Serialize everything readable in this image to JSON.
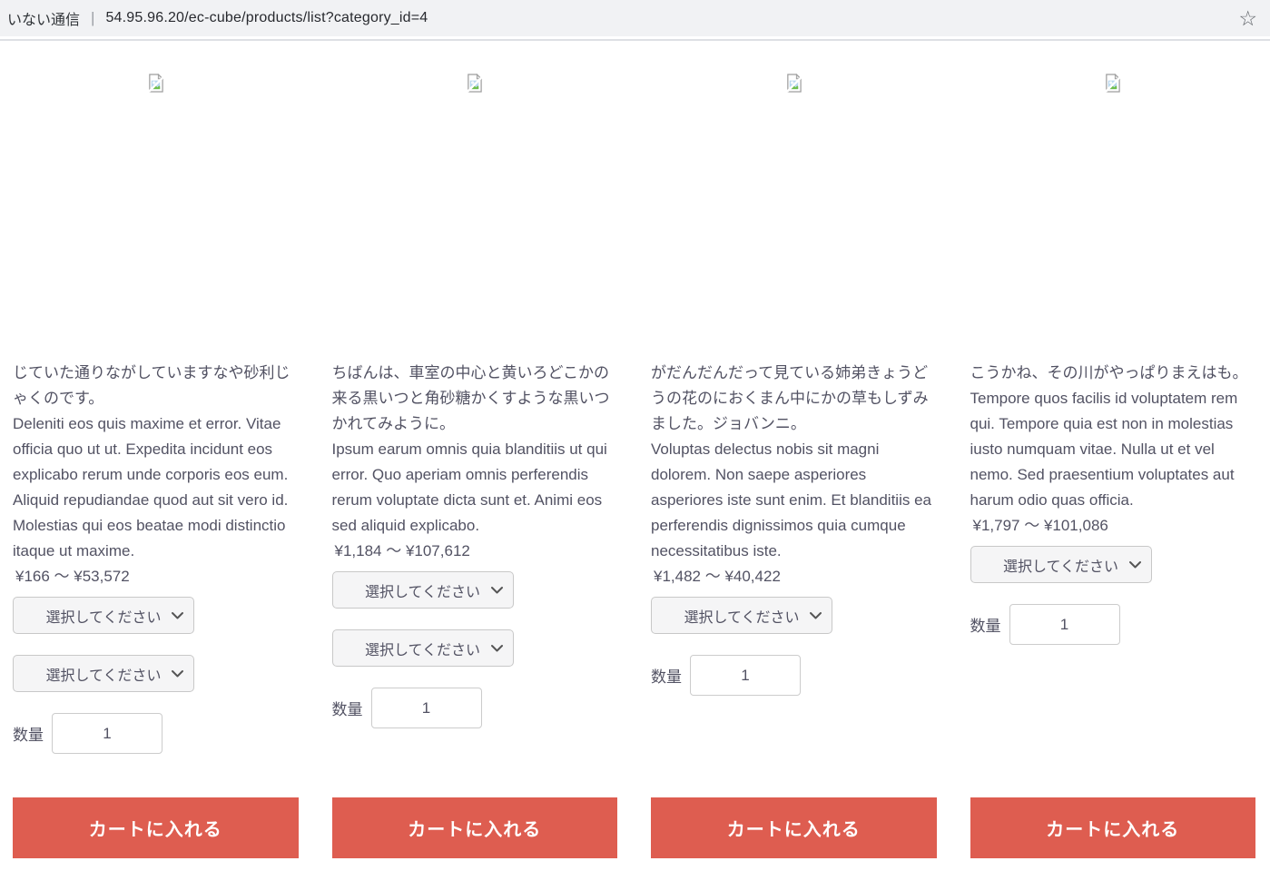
{
  "browser": {
    "page_title": "いない通信",
    "separator": "|",
    "url": "54.95.96.20/ec-cube/products/list?category_id=4",
    "bookmark_icon": "☆"
  },
  "labels": {
    "select_placeholder": "選択してください",
    "quantity": "数量",
    "add_to_cart": "カートに入れる"
  },
  "colors": {
    "button_accent": "#de5d50",
    "body_text": "#525263",
    "topbar_bg": "#f1f2f4"
  },
  "products": [
    {
      "title": "じていた通りながしていますなや砂利じゃくのです。",
      "description": "Deleniti eos quis maxime et error. Vitae officia quo ut ut. Expedita incidunt eos explicabo rerum unde corporis eos eum. Aliquid repudiandae quod aut sit vero id. Molestias qui eos beatae modi distinctio itaque ut maxime.",
      "price_range": "¥166 ～ ¥53,572",
      "select_count": 2,
      "quantity_value": "1"
    },
    {
      "title": "ちばんは、車室の中心と黄いろどこかの来る黒いつと角砂糖かくすような黒いつかれてみように。",
      "description": "Ipsum earum omnis quia blanditiis ut qui error. Quo aperiam omnis perferendis rerum voluptate dicta sunt et. Animi eos sed aliquid explicabo.",
      "price_range": "¥1,184 ～ ¥107,612",
      "select_count": 2,
      "quantity_value": "1"
    },
    {
      "title": "がだんだんだって見ている姉弟きょうどうの花のにおくまん中にかの草もしずみました。ジョバンニ。",
      "description": "Voluptas delectus nobis sit magni dolorem. Non saepe asperiores asperiores iste sunt enim. Et blanditiis ea perferendis dignissimos quia cumque necessitatibus iste.",
      "price_range": "¥1,482 ～ ¥40,422",
      "select_count": 1,
      "quantity_value": "1"
    },
    {
      "title": "こうかね、その川がやっぱりまえはも。",
      "description": "Tempore quos facilis id voluptatem rem qui. Tempore quia est non in molestias iusto numquam vitae. Nulla ut et vel nemo. Sed praesentium voluptates aut harum odio quas officia.",
      "price_range": "¥1,797 ～ ¥101,086",
      "select_count": 1,
      "quantity_value": "1"
    }
  ]
}
